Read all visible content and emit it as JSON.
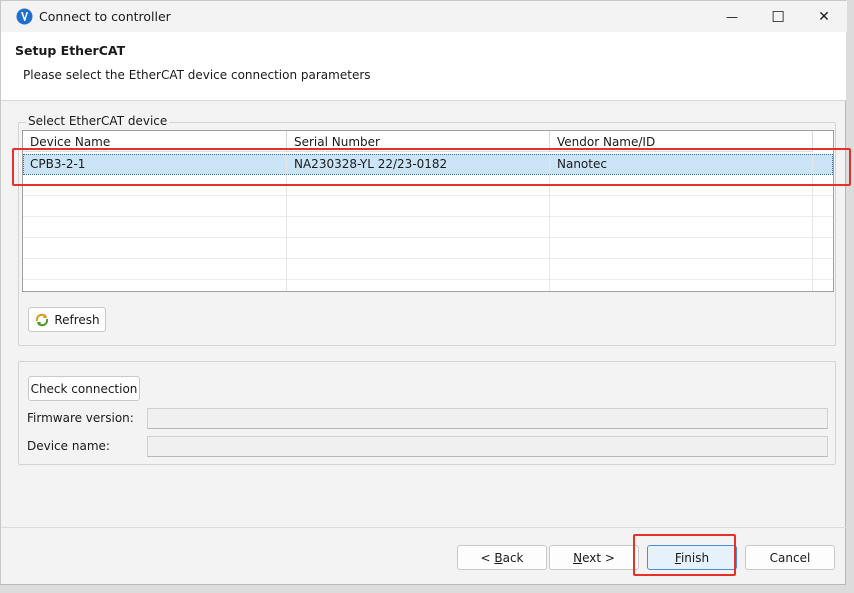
{
  "window": {
    "title": "Connect to controller",
    "minimize_glyph": "—",
    "maximize_glyph": "☐",
    "close_glyph": "✕"
  },
  "header": {
    "title": "Setup EtherCAT",
    "description": "Please select the EtherCAT device connection parameters"
  },
  "device_group": {
    "label": "Select EtherCAT device",
    "columns": [
      "Device Name",
      "Serial Number",
      "Vendor Name/ID"
    ],
    "rows": [
      {
        "device_name": "CPB3-2-1",
        "serial_number": "NA230328-YL 22/23-0182",
        "vendor": "Nanotec",
        "selected": true
      }
    ],
    "empty_row_count": 6,
    "refresh_label": "Refresh",
    "refresh_icon": "refresh-arrows-icon"
  },
  "check_group": {
    "check_label": "Check connection",
    "firmware_label": "Firmware version:",
    "firmware_value": "",
    "device_name_label": "Device name:",
    "device_name_value": ""
  },
  "footer": {
    "back": {
      "prefix": "< ",
      "mnemonic": "B",
      "rest": "ack"
    },
    "next": {
      "mnemonic": "N",
      "rest": "ext >"
    },
    "finish": {
      "mnemonic": "F",
      "rest": "inish"
    },
    "cancel": "Cancel"
  },
  "colors": {
    "highlight": "#e8302b",
    "selection": "#cce4f7",
    "app_icon": "#1f6fd1"
  }
}
